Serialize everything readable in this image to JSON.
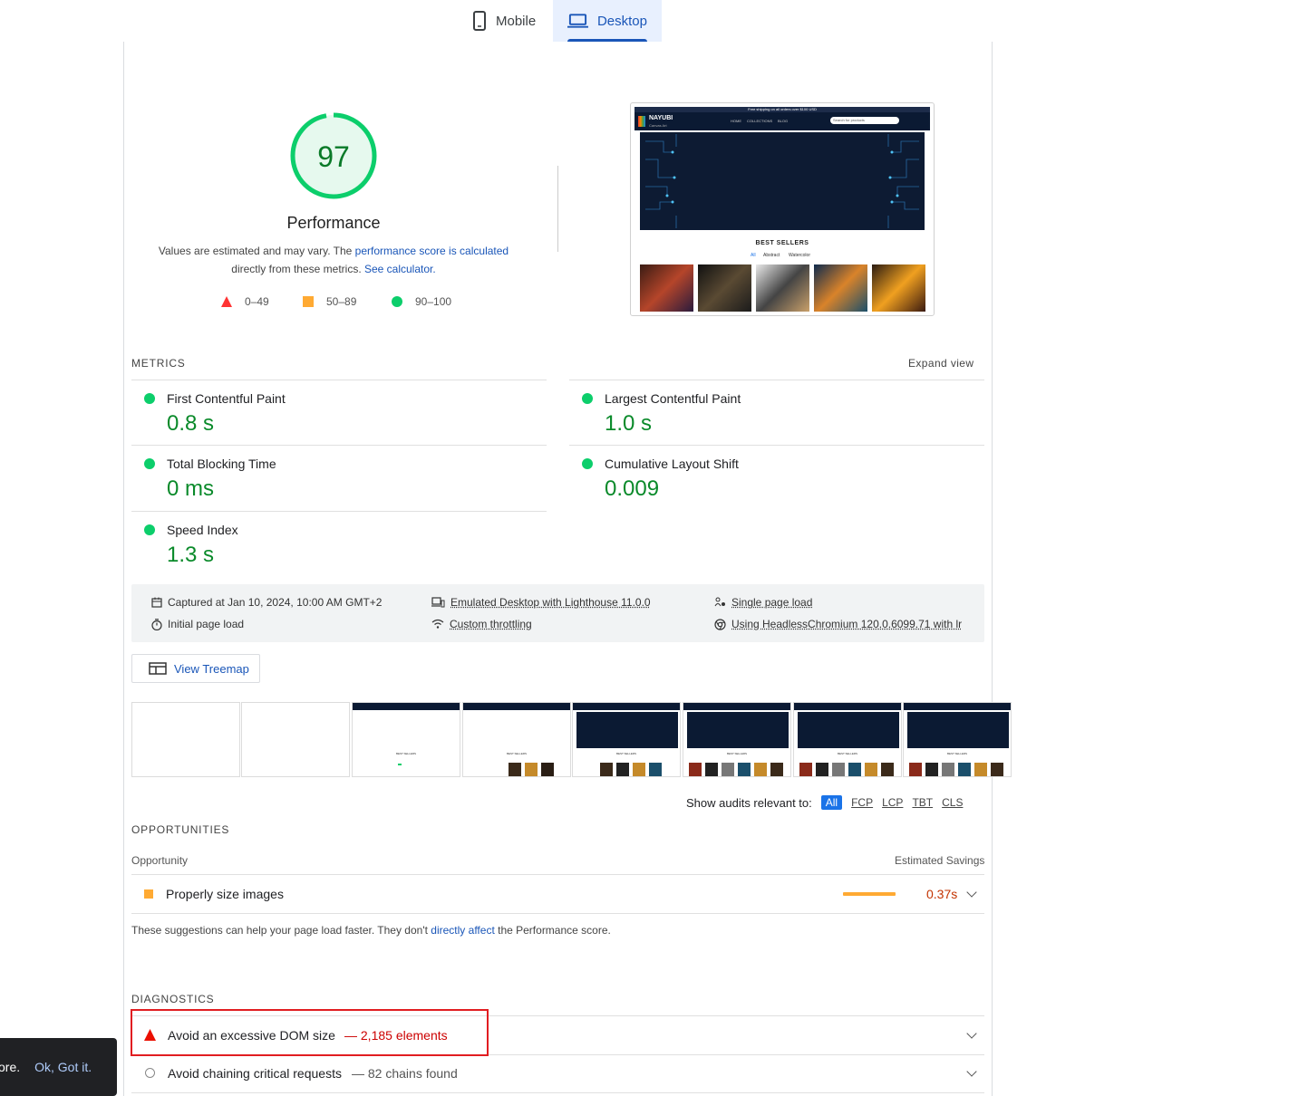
{
  "tabs": [
    {
      "label": "Mobile"
    },
    {
      "label": "Desktop"
    }
  ],
  "score": {
    "value": 97,
    "fraction": 0.97,
    "label": "Performance",
    "desc_part1": "Values are estimated and may vary. The ",
    "desc_link1": "performance score is calculated",
    "desc_part2": "directly from these metrics. ",
    "desc_link2": "See calculator.",
    "legend": [
      {
        "range": "0–49",
        "color": "#ff3333"
      },
      {
        "range": "50–89",
        "color": "#ffaa33"
      },
      {
        "range": "90–100",
        "color": "#0cce6b"
      }
    ]
  },
  "preview": {
    "banner": "Free shipping on all orders over $100 USD",
    "brand": "NAYUBI",
    "brand_sub": "Canvas Art",
    "nav": [
      "HOME",
      "COLLECTIONS",
      "BLOG"
    ],
    "search": "Search for products",
    "best_sellers": "BEST SELLERS",
    "filters": [
      "All",
      "Abstract",
      "Watercolor"
    ]
  },
  "metrics": {
    "title": "METRICS",
    "expand": "Expand view",
    "items": [
      {
        "label": "First Contentful Paint",
        "value": "0.8 s"
      },
      {
        "label": "Largest Contentful Paint",
        "value": "1.0 s"
      },
      {
        "label": "Total Blocking Time",
        "value": "0 ms"
      },
      {
        "label": "Cumulative Layout Shift",
        "value": "0.009"
      },
      {
        "label": "Speed Index",
        "value": "1.3 s"
      }
    ]
  },
  "meta": {
    "captured": "Captured at Jan 10, 2024, 10:00 AM GMT+2",
    "initial": "Initial page load",
    "emulated": "Emulated Desktop with Lighthouse 11.0.0",
    "throttling": "Custom throttling",
    "single": "Single page load",
    "browser": "Using HeadlessChromium 120.0.6099.71 with lr"
  },
  "treemap": {
    "label": "View Treemap"
  },
  "filmstrip": {
    "caption": "BEST SELLERS"
  },
  "audits_filter": {
    "label": "Show audits relevant to:",
    "options": [
      "All",
      "FCP",
      "LCP",
      "TBT",
      "CLS"
    ]
  },
  "opportunities": {
    "title": "OPPORTUNITIES",
    "col_left": "Opportunity",
    "col_right": "Estimated Savings",
    "item_title": "Properly size images",
    "item_savings": "0.37s",
    "note_part1": "These suggestions can help your page load faster. They don't ",
    "note_link": "directly affect",
    "note_part2": " the Performance score."
  },
  "diagnostics": {
    "title": "DIAGNOSTICS",
    "items": [
      {
        "title": "Avoid an excessive DOM size",
        "detail": "— 2,185 elements"
      },
      {
        "title": "Avoid chaining critical requests",
        "detail": "— 82 chains found"
      }
    ]
  },
  "toast": {
    "prefix": "ore.",
    "action": "Ok, Got it."
  }
}
